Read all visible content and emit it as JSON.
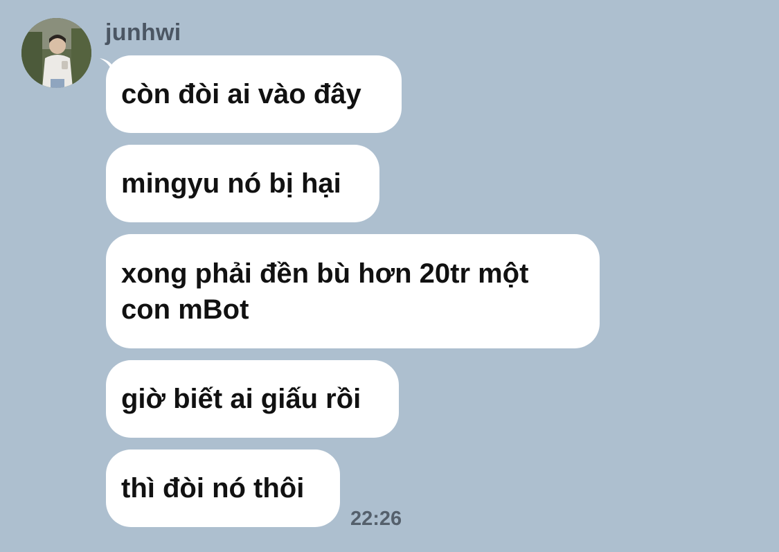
{
  "chat": {
    "sender": {
      "name": "junhwi",
      "avatar_icon": "profile-photo"
    },
    "messages": [
      {
        "text": "còn đòi ai vào đây"
      },
      {
        "text": "mingyu nó bị hại"
      },
      {
        "text": "xong phải đền bù hơn 20tr một\ncon mBot"
      },
      {
        "text": "giờ biết ai giấu rồi"
      },
      {
        "text": "thì đòi nó thôi"
      }
    ],
    "timestamp": "22:26"
  },
  "colors": {
    "background": "#adbfcf",
    "bubble": "#ffffff",
    "text": "#111111",
    "meta_text": "#55606c"
  }
}
